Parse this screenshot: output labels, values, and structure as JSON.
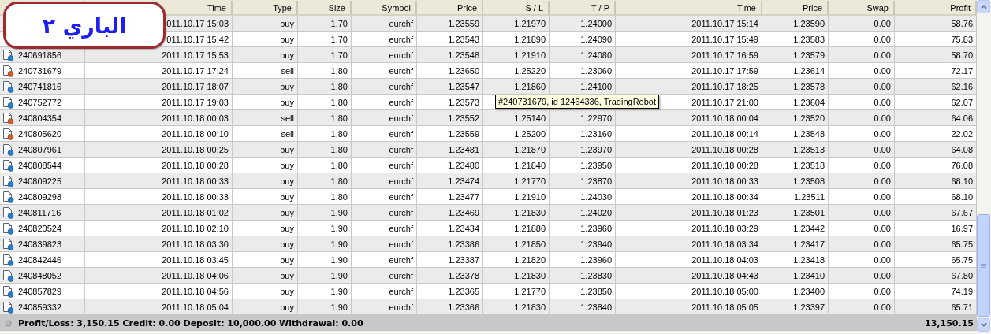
{
  "badge": {
    "text": "الباري ٢"
  },
  "columns": [
    "Time",
    "Type",
    "Size",
    "Symbol",
    "Price",
    "S / L",
    "T / P",
    "Time",
    "Price",
    "Swap",
    "Profit"
  ],
  "rows": [
    {
      "open_time": "011.10.17 15:03",
      "type": "buy",
      "size": "1.70",
      "symbol": "eurchf",
      "open_price": "1.23559",
      "sl": "1.21970",
      "tp": "1.24000",
      "close_time": "2011.10.17 15:14",
      "close_price": "1.23590",
      "swap": "0.00",
      "profit": "58.76"
    },
    {
      "open_time": "011.10.17 15:42",
      "type": "buy",
      "size": "1.70",
      "symbol": "eurchf",
      "open_price": "1.23543",
      "sl": "1.21890",
      "tp": "1.24090",
      "close_time": "2011.10.17 15:49",
      "close_price": "1.23583",
      "swap": "0.00",
      "profit": "75.83"
    },
    {
      "order": "240691856",
      "kind": "buy",
      "open_time": "2011.10.17 15:53",
      "type": "buy",
      "size": "1.70",
      "symbol": "eurchf",
      "open_price": "1.23548",
      "sl": "1.21910",
      "tp": "1.24080",
      "close_time": "2011.10.17 16:59",
      "close_price": "1.23579",
      "swap": "0.00",
      "profit": "58.70"
    },
    {
      "order": "240731679",
      "kind": "sell",
      "open_time": "2011.10.17 17:24",
      "type": "sell",
      "size": "1.80",
      "symbol": "eurchf",
      "open_price": "1.23650",
      "sl": "1.25220",
      "tp": "1.23060",
      "close_time": "2011.10.17 17:59",
      "close_price": "1.23614",
      "swap": "0.00",
      "profit": "72.17"
    },
    {
      "order": "240741816",
      "kind": "buy",
      "open_time": "2011.10.17 18:07",
      "type": "buy",
      "size": "1.80",
      "symbol": "eurchf",
      "open_price": "1.23547",
      "sl": "1.21860",
      "tp": "1.24100",
      "close_time": "2011.10.17 18:25",
      "close_price": "1.23578",
      "swap": "0.00",
      "profit": "62.16"
    },
    {
      "order": "240752772",
      "kind": "buy",
      "open_time": "2011.10.17 19:03",
      "type": "buy",
      "size": "1.80",
      "symbol": "eurchf",
      "open_price": "1.23573",
      "close_time": "2011.10.17 21:00",
      "close_price": "1.23604",
      "swap": "0.00",
      "profit": "62.07"
    },
    {
      "order": "240804354",
      "kind": "sell",
      "open_time": "2011.10.18 00:03",
      "type": "sell",
      "size": "1.80",
      "symbol": "eurchf",
      "open_price": "1.23552",
      "sl": "1.25140",
      "tp": "1.22970",
      "close_time": "2011.10.18 00:04",
      "close_price": "1.23520",
      "swap": "0.00",
      "profit": "64.06"
    },
    {
      "order": "240805620",
      "kind": "sell",
      "open_time": "2011.10.18 00:10",
      "type": "sell",
      "size": "1.80",
      "symbol": "eurchf",
      "open_price": "1.23559",
      "sl": "1.25200",
      "tp": "1.23160",
      "close_time": "2011.10.18 00:14",
      "close_price": "1.23548",
      "swap": "0.00",
      "profit": "22.02"
    },
    {
      "order": "240807961",
      "kind": "buy",
      "open_time": "2011.10.18 00:25",
      "type": "buy",
      "size": "1.80",
      "symbol": "eurchf",
      "open_price": "1.23481",
      "sl": "1.21870",
      "tp": "1.23970",
      "close_time": "2011.10.18 00:28",
      "close_price": "1.23513",
      "swap": "0.00",
      "profit": "64.08"
    },
    {
      "order": "240808544",
      "kind": "buy",
      "open_time": "2011.10.18 00:28",
      "type": "buy",
      "size": "1.80",
      "symbol": "eurchf",
      "open_price": "1.23480",
      "sl": "1.21840",
      "tp": "1.23950",
      "close_time": "2011.10.18 00:28",
      "close_price": "1.23518",
      "swap": "0.00",
      "profit": "76.08"
    },
    {
      "order": "240809225",
      "kind": "buy",
      "open_time": "2011.10.18 00:33",
      "type": "buy",
      "size": "1.80",
      "symbol": "eurchf",
      "open_price": "1.23474",
      "sl": "1.21770",
      "tp": "1.23870",
      "close_time": "2011.10.18 00:33",
      "close_price": "1.23508",
      "swap": "0.00",
      "profit": "68.10"
    },
    {
      "order": "240809298",
      "kind": "buy",
      "open_time": "2011.10.18 00:33",
      "type": "buy",
      "size": "1.80",
      "symbol": "eurchf",
      "open_price": "1.23477",
      "sl": "1.21910",
      "tp": "1.24030",
      "close_time": "2011.10.18 00:34",
      "close_price": "1.23511",
      "swap": "0.00",
      "profit": "68.10"
    },
    {
      "order": "240811716",
      "kind": "buy",
      "open_time": "2011.10.18 01:02",
      "type": "buy",
      "size": "1.90",
      "symbol": "eurchf",
      "open_price": "1.23469",
      "sl": "1.21830",
      "tp": "1.24020",
      "close_time": "2011.10.18 01:23",
      "close_price": "1.23501",
      "swap": "0.00",
      "profit": "67.67"
    },
    {
      "order": "240820524",
      "kind": "buy",
      "open_time": "2011.10.18 02:10",
      "type": "buy",
      "size": "1.90",
      "symbol": "eurchf",
      "open_price": "1.23434",
      "sl": "1.21880",
      "tp": "1.23960",
      "close_time": "2011.10.18 03:29",
      "close_price": "1.23442",
      "swap": "0.00",
      "profit": "16.97"
    },
    {
      "order": "240839823",
      "kind": "buy",
      "open_time": "2011.10.18 03:30",
      "type": "buy",
      "size": "1.90",
      "symbol": "eurchf",
      "open_price": "1.23386",
      "sl": "1.21850",
      "tp": "1.23940",
      "close_time": "2011.10.18 03:34",
      "close_price": "1.23417",
      "swap": "0.00",
      "profit": "65.75"
    },
    {
      "order": "240842446",
      "kind": "buy",
      "open_time": "2011.10.18 03:45",
      "type": "buy",
      "size": "1.90",
      "symbol": "eurchf",
      "open_price": "1.23387",
      "sl": "1.21820",
      "tp": "1.23960",
      "close_time": "2011.10.18 04:03",
      "close_price": "1.23418",
      "swap": "0.00",
      "profit": "65.75"
    },
    {
      "order": "240848052",
      "kind": "buy",
      "open_time": "2011.10.18 04:06",
      "type": "buy",
      "size": "1.90",
      "symbol": "eurchf",
      "open_price": "1.23378",
      "sl": "1.21830",
      "tp": "1.23830",
      "close_time": "2011.10.18 04:43",
      "close_price": "1.23410",
      "swap": "0.00",
      "profit": "67.80"
    },
    {
      "order": "240857829",
      "kind": "buy",
      "open_time": "2011.10.18 04:56",
      "type": "buy",
      "size": "1.90",
      "symbol": "eurchf",
      "open_price": "1.23365",
      "sl": "1.21770",
      "tp": "1.23850",
      "close_time": "2011.10.18 05:00",
      "close_price": "1.23400",
      "swap": "0.00",
      "profit": "74.19"
    },
    {
      "order": "240859332",
      "kind": "buy",
      "open_time": "2011.10.18 05:04",
      "type": "buy",
      "size": "1.90",
      "symbol": "eurchf",
      "open_price": "1.23366",
      "sl": "1.21830",
      "tp": "1.23840",
      "close_time": "2011.10.18 05:05",
      "close_price": "1.23397",
      "swap": "0.00",
      "profit": "65.71"
    }
  ],
  "tooltip": {
    "text": "#240731679, id 12464336, TradingRobot"
  },
  "status_bar": {
    "summary": "Profit/Loss: 3,150.15  Credit: 0.00  Deposit: 10,000.00  Withdrawal: 0.00",
    "total": "13,150.15"
  }
}
